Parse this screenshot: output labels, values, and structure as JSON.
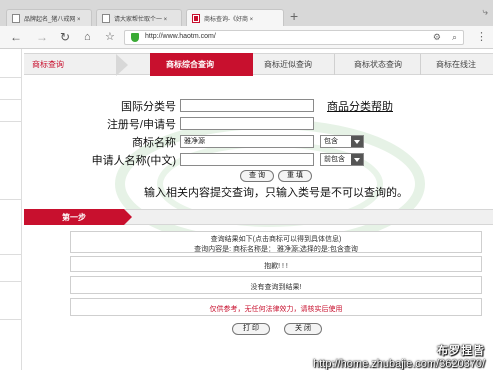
{
  "browser": {
    "tabs": [
      {
        "title": "品牌起名_猪八戒网 ×",
        "close": "×"
      },
      {
        "title": "请大家帮忙取个一 ×",
        "close": "×"
      },
      {
        "title": "商标查询-《好商 ×",
        "close": "×"
      }
    ],
    "new_tab": "+",
    "url": "http://www.haotm.com/"
  },
  "site_nav": {
    "items": [
      "商标查询",
      "商标综合查询",
      "商标近似查询",
      "商标状态查询",
      "商标在线注"
    ],
    "active_index": 1
  },
  "search_form": {
    "class_no_label": "国际分类号",
    "class_help_link": "商品分类帮助",
    "reg_no_label": "注册号/申请号",
    "tm_name_label": "商标名称",
    "tm_name_value": "雅净源",
    "tm_name_match": "包含",
    "applicant_label": "申请人名称(中文)",
    "applicant_match": "前包含",
    "search_button": "查 询",
    "reset_button": "重 填",
    "hint": "输入相关内容提交查询，只输入类号是不可以查询的。"
  },
  "step": {
    "label": "第一步"
  },
  "results": {
    "header_line1": "查询结果如下(点击商标可以得到具体信息)",
    "header_line2": "查询内容是: 商标名称是： 雅净源;选择的是:包含查询",
    "sorry": "抱歉! ! !",
    "no_result": "没有查询到结果!",
    "disclaimer": "仅供参考，无任何法律效力，请核实后使用",
    "print_button": "打 印",
    "close_button": "关 闭"
  },
  "watermark": {
    "brand": "布罗捏皆",
    "url": "http://home.zhubajie.com/3620370/"
  },
  "colors": {
    "accent": "#c8102e",
    "shield": "#3aaa35"
  }
}
